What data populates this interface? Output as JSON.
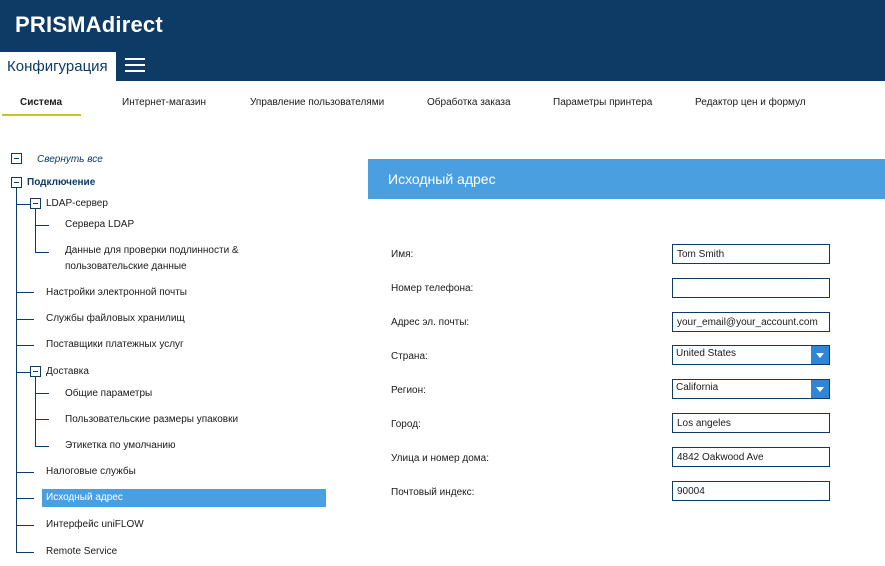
{
  "header": {
    "brand": "PRISMAdirect",
    "config_label": "Конфигурация"
  },
  "tabs": [
    {
      "label": "Система",
      "active": true
    },
    {
      "label": "Интернет-магазин"
    },
    {
      "label": "Управление пользователями"
    },
    {
      "label": "Обработка заказа"
    },
    {
      "label": "Параметры принтера"
    },
    {
      "label": "Редактор цен и формул"
    }
  ],
  "tree": {
    "collapse_all": "Свернуть все",
    "root": "Подключение",
    "ldap": "LDAP-сервер",
    "ldap_servers": "Сервера LDAP",
    "ldap_auth_line1": "Данные для проверки подлинности &",
    "ldap_auth_line2": "пользовательские данные",
    "email": "Настройки электронной почты",
    "file_storage": "Службы файловых хранилищ",
    "payment": "Поставщики платежных услуг",
    "delivery": "Доставка",
    "general": "Общие параметры",
    "custom_sizes": "Пользовательские размеры упаковки",
    "default_label": "Этикетка по умолчанию",
    "tax": "Налоговые службы",
    "source_address": "Исходный адрес",
    "uniflow": "Интерфейс uniFLOW",
    "remote": "Remote Service"
  },
  "panel": {
    "title": "Исходный адрес",
    "fields": {
      "name_label": "Имя:",
      "name_value": "Tom Smith",
      "phone_label": "Номер телефона:",
      "phone_value": "",
      "email_label": "Адрес эл. почты:",
      "email_value": "your_email@your_account.com",
      "country_label": "Страна:",
      "country_value": "United States",
      "region_label": "Регион:",
      "region_value": "California",
      "city_label": "Город:",
      "city_value": "Los angeles",
      "street_label": "Улица и номер дома:",
      "street_value": "4842 Oakwood Ave",
      "zip_label": "Почтовый индекс:",
      "zip_value": "90004"
    }
  },
  "colors": {
    "brand_navy": "#0e3a66",
    "accent_blue": "#4a9fe0",
    "tab_underline": "#c8c22a"
  }
}
